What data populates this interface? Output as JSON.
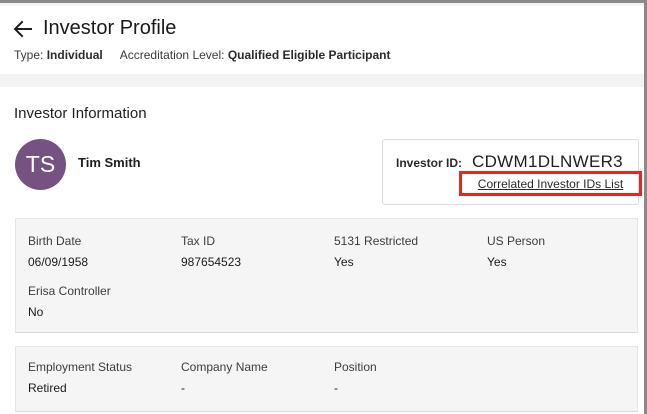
{
  "header": {
    "title": "Investor Profile",
    "type_label": "Type:",
    "type_value": "Individual",
    "accreditation_label": "Accreditation Level:",
    "accreditation_value": "Qualified Eligible Participant"
  },
  "section": {
    "title": "Investor Information"
  },
  "investor": {
    "initials": "TS",
    "name": "Tim Smith",
    "id_label": "Investor ID:",
    "id_value": "CDWM1DLNWER3",
    "correlated_link": "Correlated Investor IDs List",
    "avatar_color": "#765283"
  },
  "details": [
    {
      "label": "Birth Date",
      "value": "06/09/1958"
    },
    {
      "label": "Tax ID",
      "value": "987654523"
    },
    {
      "label": "5131 Restricted",
      "value": "Yes"
    },
    {
      "label": "US Person",
      "value": "Yes"
    },
    {
      "label": "Erisa Controller",
      "value": "No"
    }
  ],
  "employment": [
    {
      "label": "Employment Status",
      "value": "Retired"
    },
    {
      "label": "Company Name",
      "value": "-"
    },
    {
      "label": "Position",
      "value": "-"
    }
  ],
  "colors": {
    "highlight": "#e8261b"
  }
}
